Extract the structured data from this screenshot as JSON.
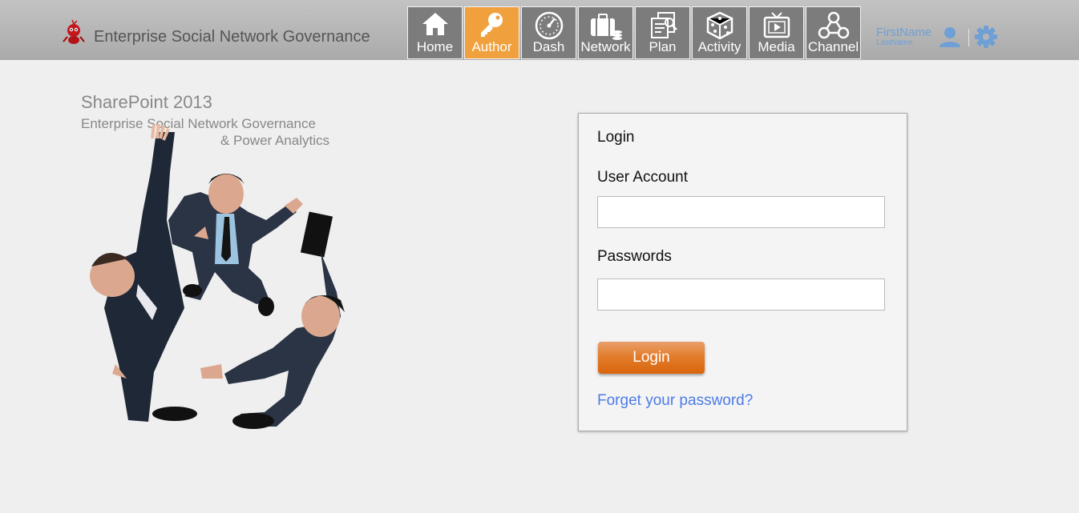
{
  "header": {
    "app_title": "Enterprise Social Network Governance",
    "nav": [
      {
        "label": "Home",
        "icon": "home-icon",
        "active": false
      },
      {
        "label": "Author",
        "icon": "key-icon",
        "active": true
      },
      {
        "label": "Dash",
        "icon": "dashboard-gauge-icon",
        "active": false
      },
      {
        "label": "Network",
        "icon": "briefcase-network-icon",
        "active": false
      },
      {
        "label": "Plan",
        "icon": "plan-documents-icon",
        "active": false
      },
      {
        "label": "Activity",
        "icon": "dice-icon",
        "active": false
      },
      {
        "label": "Media",
        "icon": "tv-play-icon",
        "active": false
      },
      {
        "label": "Channel",
        "icon": "channel-nodes-icon",
        "active": false
      }
    ],
    "user": {
      "first_name": "FirstName",
      "last_name": "LastName"
    },
    "colors": {
      "active_nav": "#f0a13e",
      "nav_bg": "#7c7c7c",
      "user_blue": "#6ea0d5"
    }
  },
  "hero": {
    "title": "SharePoint 2013",
    "subtitle_line1": "Enterprise Social Network Governance",
    "subtitle_line2": "& Power Analytics",
    "image": "business-people-illustration"
  },
  "login": {
    "title": "Login",
    "account_label": "User Account",
    "account_value": "",
    "password_label": "Passwords",
    "password_value": "",
    "button_label": "Login",
    "forgot_label": "Forget your password?",
    "colors": {
      "button": "#e27d2d",
      "link": "#4c7be6"
    }
  }
}
